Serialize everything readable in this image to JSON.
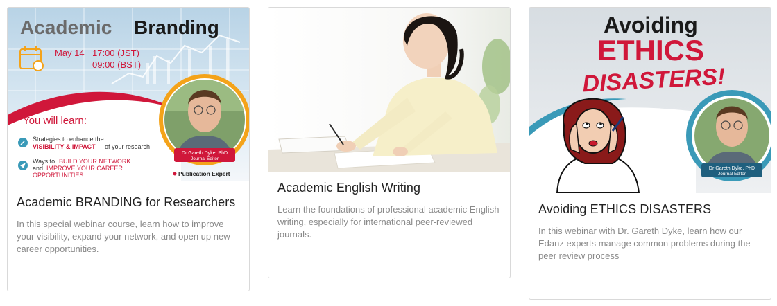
{
  "cards": [
    {
      "banner": {
        "headline_1": "Academic",
        "headline_2": "Branding",
        "date": "May 14",
        "time_1": "17:00 (JST)",
        "time_2": "09:00 (BST)",
        "learn_heading": "You will learn:",
        "point_1_line_1": "Strategies to enhance the",
        "point_1_line_2": "VISIBILITY & IMPACT",
        "point_1_line_2_rest": "of your research",
        "point_2_line_1": "Ways to",
        "point_2_line_1_em": "BUILD YOUR NETWORK",
        "point_2_line_2": "and",
        "point_2_line_2_em": "IMPROVE YOUR CAREER",
        "point_2_line_3_em": "OPPORTUNITIES",
        "speaker_name": "Dr Gareth Dyke, PhD",
        "speaker_role": "Journal Editor",
        "badge": "Publication Expert"
      },
      "title": "Academic BRANDING for Researchers",
      "description": "In this special webinar course, learn how to improve your visibility, expand your network, and open up new career opportunities."
    },
    {
      "title": "Academic English Writing",
      "description": "Learn the foundations of professional academic English writing, especially for international peer-reviewed journals."
    },
    {
      "banner": {
        "headline_1": "Avoiding",
        "headline_2": "ETHICS",
        "headline_3": "DISASTERS!",
        "speaker_name": "Dr Gareth Dyke, PhD",
        "speaker_role": "Journal Editor"
      },
      "title": "Avoiding ETHICS DISASTERS",
      "description": "In this webinar with Dr. Gareth Dyke, learn how our Edanz experts manage common problems during the peer review process"
    }
  ],
  "colors": {
    "brand_red": "#d0173a",
    "brand_orange": "#f4a31a",
    "teal": "#3a9ab8",
    "card_border": "#d9d9d9"
  }
}
